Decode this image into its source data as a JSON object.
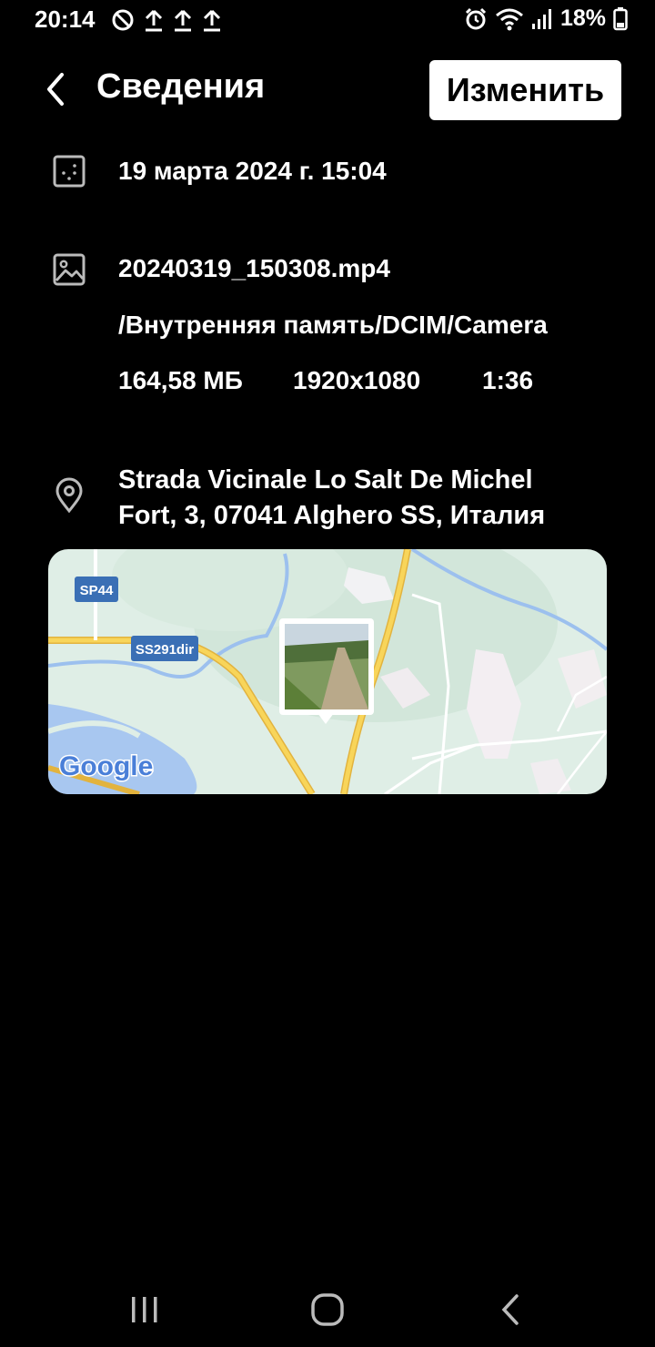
{
  "status_bar": {
    "time": "20:14",
    "left_icons": [
      "sync-off-icon",
      "upload-icon",
      "upload-icon",
      "upload-icon"
    ],
    "right_icons": [
      "alarm-icon",
      "wifi-icon",
      "signal-icon",
      "battery-icon"
    ],
    "battery": "18%"
  },
  "header": {
    "title": "Сведения",
    "edit_label": "Изменить"
  },
  "details": {
    "date": "19 марта 2024 г. 15:04",
    "filename": "20240319_150308.mp4",
    "path": "/Внутренняя память/DCIM/Camera",
    "size": "164,58 МБ",
    "resolution": "1920x1080",
    "duration": "1:36"
  },
  "location": {
    "address_line1": "Strada Vicinale Lo Salt De Michel",
    "address_line2": "Fort, 3, 07041 Alghero SS, Италия",
    "map_labels": {
      "road1": "SP44",
      "road2": "SS291dir",
      "attribution": "Google"
    }
  },
  "colors": {
    "background": "#000000",
    "map_land": "#dfeee6",
    "map_water": "#a8c7f0",
    "road": "#f5c84a",
    "road_label": "#3a6fb5"
  }
}
